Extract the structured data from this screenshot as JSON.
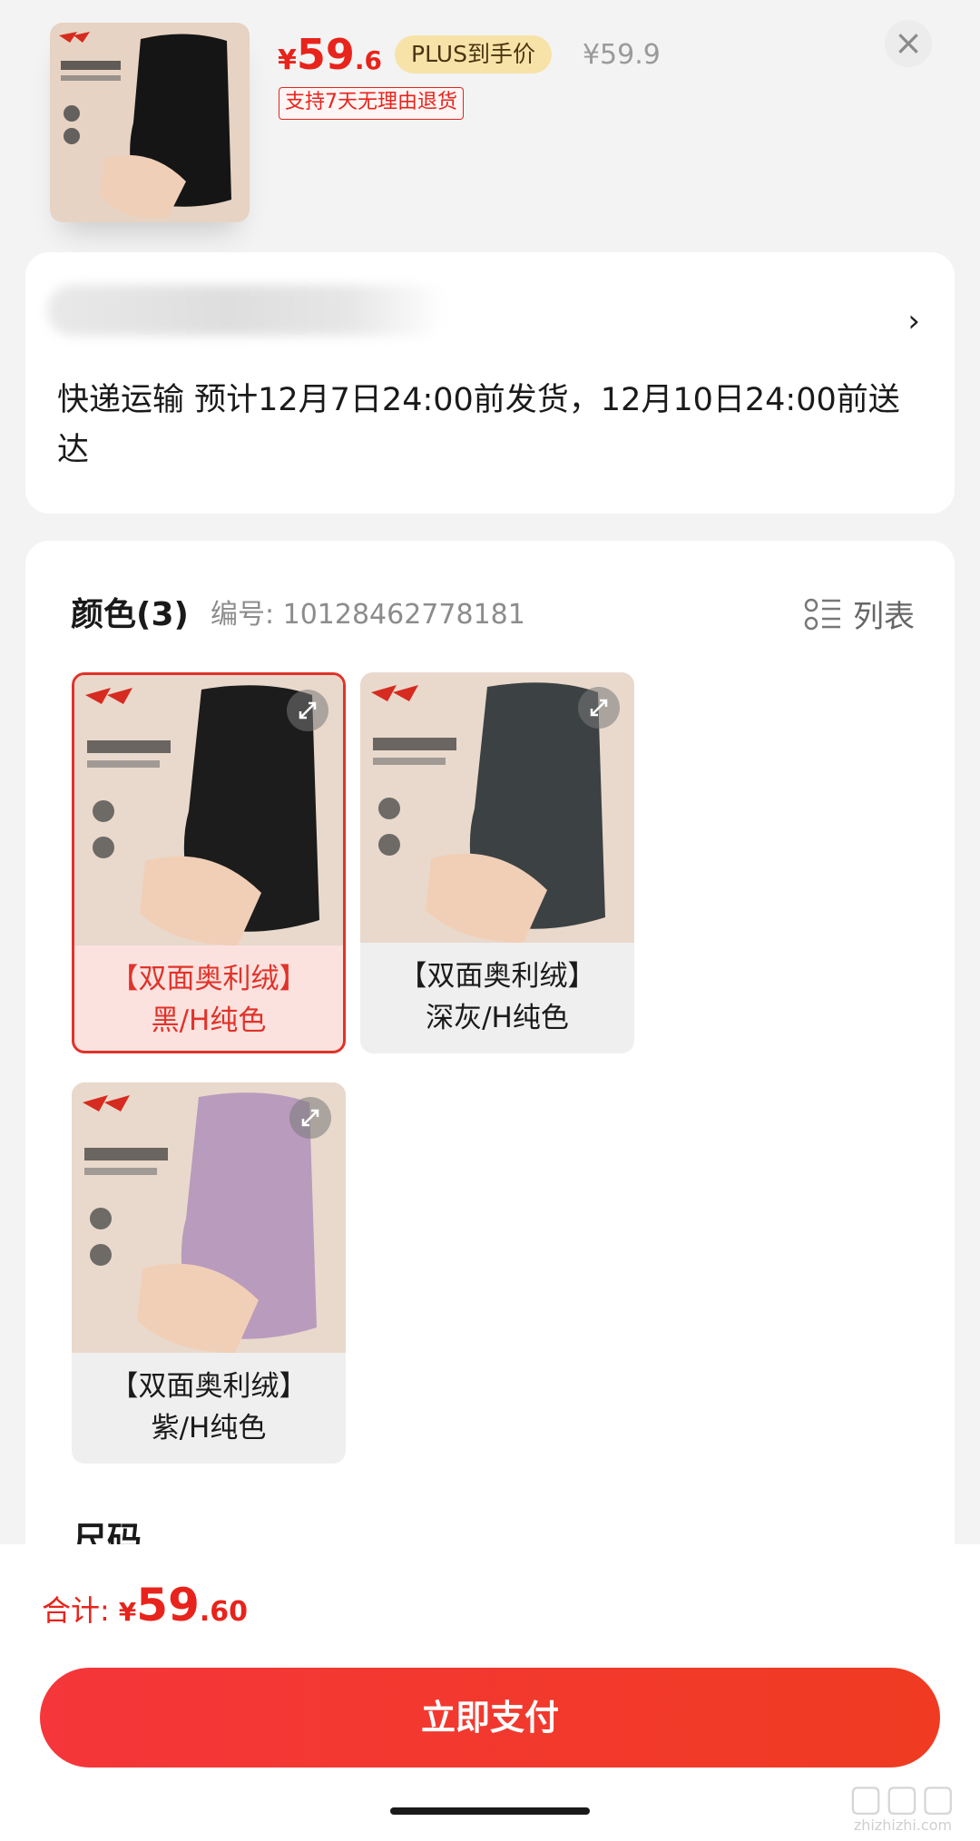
{
  "product": {
    "price_symbol": "¥",
    "price_int": "59",
    "price_dec": ".6",
    "plus_badge": "PLUS到手价",
    "original_price": "¥59.9",
    "return_policy": "支持7天无理由退货",
    "close": "×"
  },
  "shipping": {
    "arrow": "›",
    "text": "快递运输 预计12月7日24:00前发货，12月10日24:00前送达"
  },
  "options": {
    "title": "颜色(3)",
    "code": "编号: 10128462778181",
    "list_label": "列表",
    "swatches": [
      {
        "line1": "【双面奥利绒】",
        "line2": "黑/H纯色",
        "color": "#1c1c1c",
        "bg": "#e9d9cc",
        "selected": true
      },
      {
        "line1": "【双面奥利绒】",
        "line2": "深灰/H纯色",
        "color": "#3c4143",
        "bg": "#e9d9cc",
        "selected": false
      },
      {
        "line1": "【双面奥利绒】",
        "line2": "紫/H纯色",
        "color": "#b99bbd",
        "bg": "#e9d9cc",
        "selected": false
      }
    ],
    "size_title": "尺码"
  },
  "footer": {
    "total_label": "合计:",
    "total_symbol": "¥",
    "total_int": "59",
    "total_dec": ".60",
    "pay_button": "立即支付",
    "watermark": "zhizhizhi.com"
  },
  "colors": {
    "accent": "#e8231b",
    "plus_bg": "#f7e3a8"
  }
}
